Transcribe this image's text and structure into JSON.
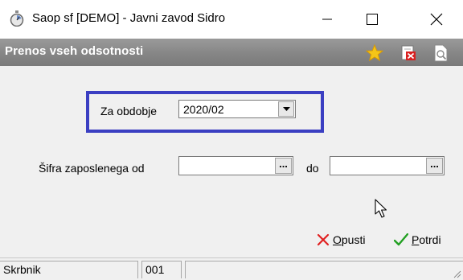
{
  "window": {
    "title": "Saop sf [DEMO] - Javni zavod Sidro",
    "icons": [
      "stopwatch-icon",
      "minimize-icon",
      "maximize-icon",
      "close-icon"
    ]
  },
  "form": {
    "title": "Prenos vseh odsotnosti",
    "header_icons": [
      "star-icon",
      "delete-icon",
      "preview-icon"
    ],
    "period_label": "Za obdobje",
    "period_value": "2020/02",
    "employee_from_label": "Šifra zaposlenega od",
    "employee_from_value": "",
    "employee_to_label": "do",
    "employee_to_value": "",
    "ellipsis": "...",
    "highlight_color": "#3b3fc2"
  },
  "actions": {
    "cancel_prefix": "",
    "cancel_underlined": "O",
    "cancel_rest": "pusti",
    "confirm_underlined": "P",
    "confirm_rest": "otrdi"
  },
  "statusbar": {
    "user": "Skrbnik",
    "code": "001"
  }
}
